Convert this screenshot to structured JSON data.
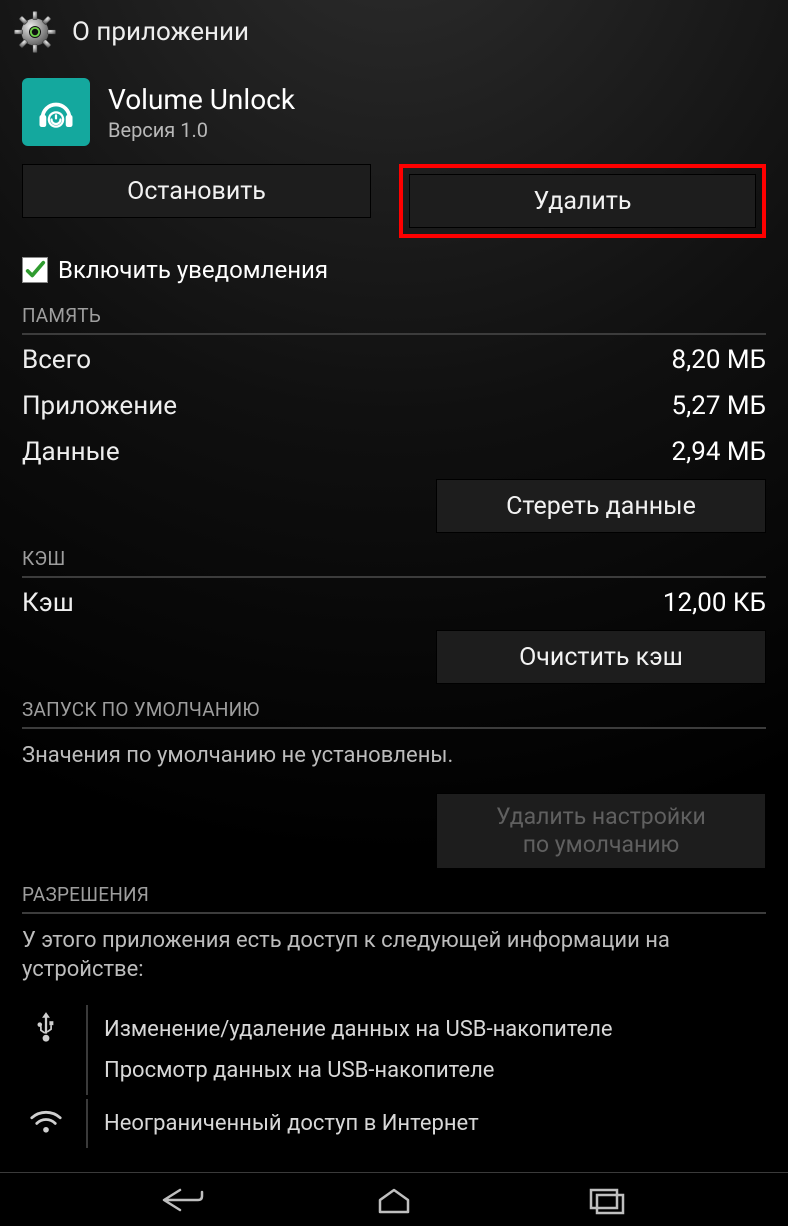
{
  "header": {
    "title": "О приложении"
  },
  "app": {
    "name": "Volume Unlock",
    "version": "Версия 1.0"
  },
  "buttons": {
    "force_stop": "Остановить",
    "uninstall": "Удалить",
    "clear_data": "Стереть данные",
    "clear_cache": "Очистить кэш",
    "clear_defaults_line1": "Удалить настройки",
    "clear_defaults_line2": "по умолчанию"
  },
  "notifications": {
    "checkbox_label": "Включить уведомления",
    "checked": true
  },
  "sections": {
    "storage_title": "ПАМЯТЬ",
    "cache_title": "КЭШ",
    "defaults_title": "ЗАПУСК ПО УМОЛЧАНИЮ",
    "permissions_title": "РАЗРЕШЕНИЯ"
  },
  "storage": {
    "total_label": "Всего",
    "total_value": "8,20 МБ",
    "app_label": "Приложение",
    "app_value": "5,27 МБ",
    "data_label": "Данные",
    "data_value": "2,94 МБ"
  },
  "cache": {
    "label": "Кэш",
    "value": "12,00 КБ"
  },
  "defaults": {
    "status": "Значения по умолчанию не установлены."
  },
  "permissions": {
    "intro": "У этого приложения есть доступ к следующей информации на устройстве:",
    "groups": [
      {
        "icon": "usb-icon",
        "items": [
          "Изменение/удаление данных на USB-накопителе",
          "Просмотр данных на USB-накопителе"
        ]
      },
      {
        "icon": "wifi-icon",
        "items": [
          "Неограниченный доступ в Интернет"
        ]
      }
    ]
  }
}
